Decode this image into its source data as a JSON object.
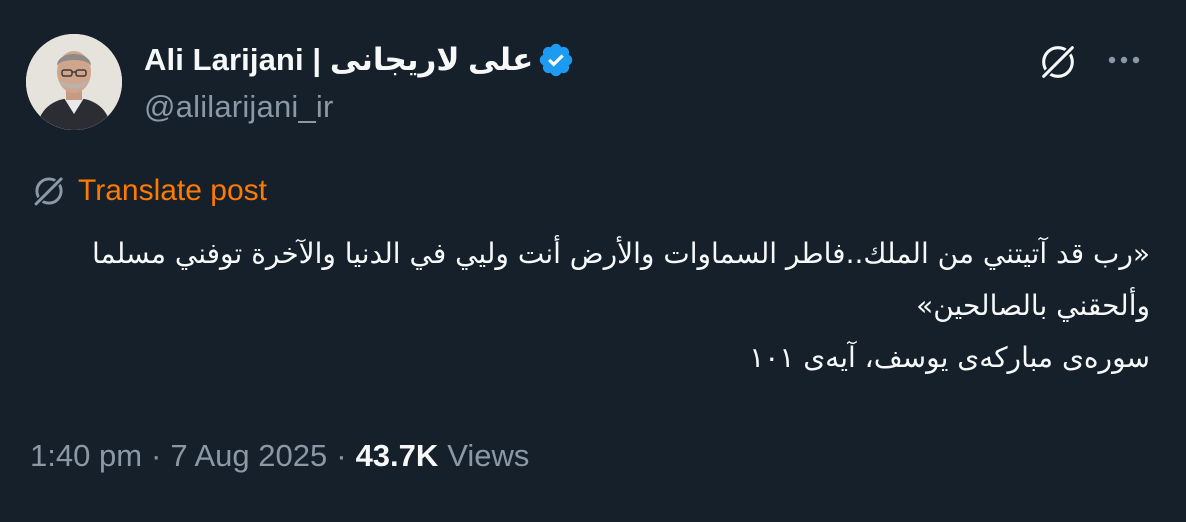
{
  "author": {
    "display_name": "Ali Larijani | علی لاریجانی",
    "handle": "@alilarijani_ir",
    "verified": true,
    "avatar": "profile-photo"
  },
  "actions": {
    "grok_icon": "grok-icon",
    "more_icon": "more-horizontal-icon"
  },
  "translate": {
    "label": "Translate post",
    "icon": "grok-icon",
    "color": "#ff7a00"
  },
  "post": {
    "lines": [
      "«رب قد آتيتني من الملك..فاطر السماوات والأرض أنت وليي في الدنيا والآخرة توفني مسلما وألحقني بالصالحين»",
      "سوره‌ی مبارکه‌ی یوسف، آیه‌ی ۱۰۱"
    ]
  },
  "meta": {
    "time": "1:40 pm",
    "separator": "·",
    "date": "7 Aug 2025",
    "views_count": "43.7K",
    "views_label": "Views"
  },
  "colors": {
    "background": "#15202b",
    "primary_text": "#f7f9f9",
    "secondary_text": "#8b98a5",
    "verified_badge": "#1d9bf0"
  }
}
